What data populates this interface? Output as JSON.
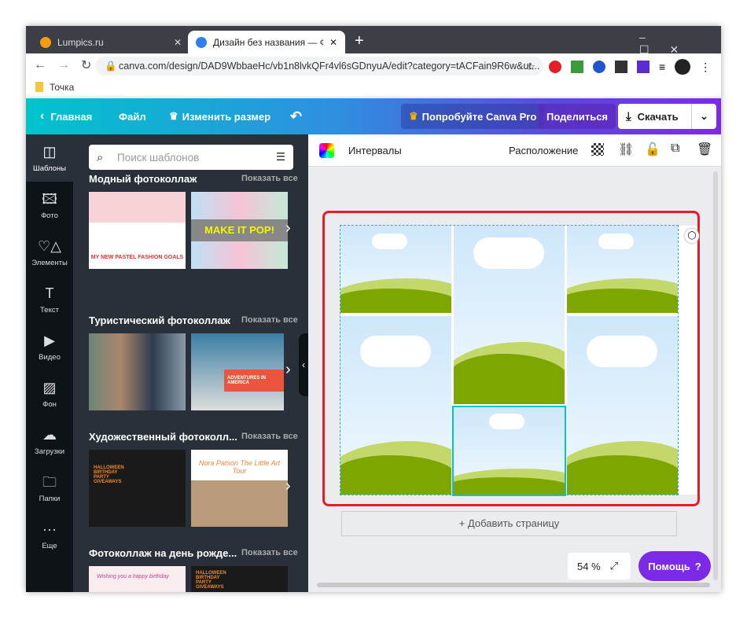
{
  "browser": {
    "tabs": [
      {
        "title": "Lumpics.ru",
        "active": false
      },
      {
        "title": "Дизайн без названия — Фотоколлаж",
        "active": true
      }
    ],
    "url": "canva.com/design/DAD9WbbaeHc/vb1n8lvkQFr4vl6sGDnyuA/edit?category=tACFain9R6w&ut...",
    "bookmark": "Точка",
    "ext_badges": [
      "1",
      "1"
    ]
  },
  "header": {
    "home": "Главная",
    "file": "Файл",
    "resize": "Изменить размер",
    "try_pro": "Попробуйте Canva Pro",
    "share": "Поделиться",
    "download": "Скачать"
  },
  "rail": [
    {
      "label": "Шаблоны",
      "icon": "templates-icon"
    },
    {
      "label": "Фото",
      "icon": "photo-icon"
    },
    {
      "label": "Элементы",
      "icon": "elements-icon"
    },
    {
      "label": "Текст",
      "icon": "text-icon"
    },
    {
      "label": "Видео",
      "icon": "video-icon"
    },
    {
      "label": "Фон",
      "icon": "background-icon"
    },
    {
      "label": "Загрузки",
      "icon": "upload-icon"
    },
    {
      "label": "Папки",
      "icon": "folder-icon"
    },
    {
      "label": "Еще",
      "icon": "more-icon"
    }
  ],
  "panel": {
    "search_placeholder": "Поиск шаблонов",
    "show_all": "Показать все",
    "sections": [
      {
        "title": "Модный фотоколлаж",
        "thumbs": [
          "MY NEW PASTEL FASHION GOALS",
          "MAKE IT POP!"
        ]
      },
      {
        "title": "Туристический фотоколлаж",
        "thumbs": [
          "",
          "ADVENTURES IN AMERICA"
        ]
      },
      {
        "title": "Художественный фотоколл...",
        "thumbs": [
          "HALLOWEEN BIRTHDAY PARTY GIVEAWAYS",
          "Nora Patson The Little Art Tour"
        ]
      },
      {
        "title": "Фотоколлаж на день рожде...",
        "thumbs": [
          "Wishing you a happy birthday",
          "HALLOWEEN BIRTHDAY PARTY GIVEAWAYS"
        ]
      }
    ]
  },
  "toolbar": {
    "spacing": "Интервалы",
    "position": "Расположение"
  },
  "canvas": {
    "add_page": "+ Добавить страницу",
    "zoom": "54 %",
    "help": "Помощь",
    "help_icon": "?"
  },
  "colors": {
    "accent": "#7d2ae8",
    "selection": "#00c4cc",
    "highlight": "#e31e24"
  }
}
